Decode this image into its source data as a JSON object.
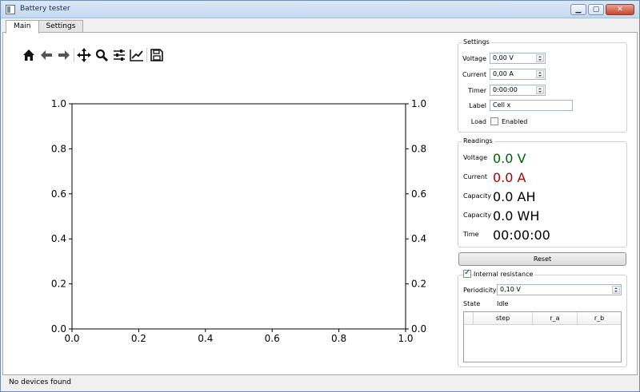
{
  "window": {
    "title": "Battery tester",
    "buttons": {
      "minimize": "▁",
      "maximize": "▢",
      "close": "✕"
    }
  },
  "tabs": [
    {
      "label": "Main",
      "active": true
    },
    {
      "label": "Settings",
      "active": false
    }
  ],
  "toolbar": {
    "icons": [
      "home-icon",
      "back-arrow-icon",
      "forward-arrow-icon",
      "pan-icon",
      "zoom-icon",
      "subplots-config-icon",
      "edit-axis-icon",
      "save-icon"
    ]
  },
  "chart_data": {
    "type": "line",
    "series": [],
    "xlim": [
      0.0,
      1.0
    ],
    "ylim": [
      0.0,
      1.0
    ],
    "x_ticks": [
      "0.0",
      "0.2",
      "0.4",
      "0.6",
      "0.8",
      "1.0"
    ],
    "y_ticks": [
      "0.0",
      "0.2",
      "0.4",
      "0.6",
      "0.8",
      "1.0"
    ],
    "y_right_ticks": [
      "0.0",
      "0.2",
      "0.4",
      "0.6",
      "0.8",
      "1.0"
    ],
    "grid": false
  },
  "settings": {
    "title": "Settings",
    "voltage": {
      "label": "Voltage",
      "value": "0,00 V"
    },
    "current": {
      "label": "Current",
      "value": "0,00 A"
    },
    "timer": {
      "label": "Timer",
      "value": "0:00:00"
    },
    "cell_label": {
      "label": "Label",
      "value": "Cell x"
    },
    "load": {
      "label": "Load",
      "checkbox_label": "Enabled",
      "checked": false
    }
  },
  "readings": {
    "title": "Readings",
    "voltage": {
      "label": "Voltage",
      "value": "0.0 V",
      "color": "#006400"
    },
    "current": {
      "label": "Current",
      "value": "0.0 A",
      "color": "#b00000"
    },
    "capacity_ah": {
      "label": "Capacity",
      "value": "0.0 AH"
    },
    "capacity_wh": {
      "label": "Capacity",
      "value": "0.0 WH"
    },
    "time": {
      "label": "Time",
      "value": "00:00:00"
    }
  },
  "reset_label": "Reset",
  "internal_resistance": {
    "title": "Internal resistance",
    "checked": true,
    "periodicity": {
      "label": "Periodicity",
      "value": "0,10 V"
    },
    "state": {
      "label": "State",
      "value": "Idle"
    },
    "table": {
      "columns": [
        "step",
        "r_a",
        "r_b"
      ],
      "rows": []
    }
  },
  "status": "No devices found"
}
